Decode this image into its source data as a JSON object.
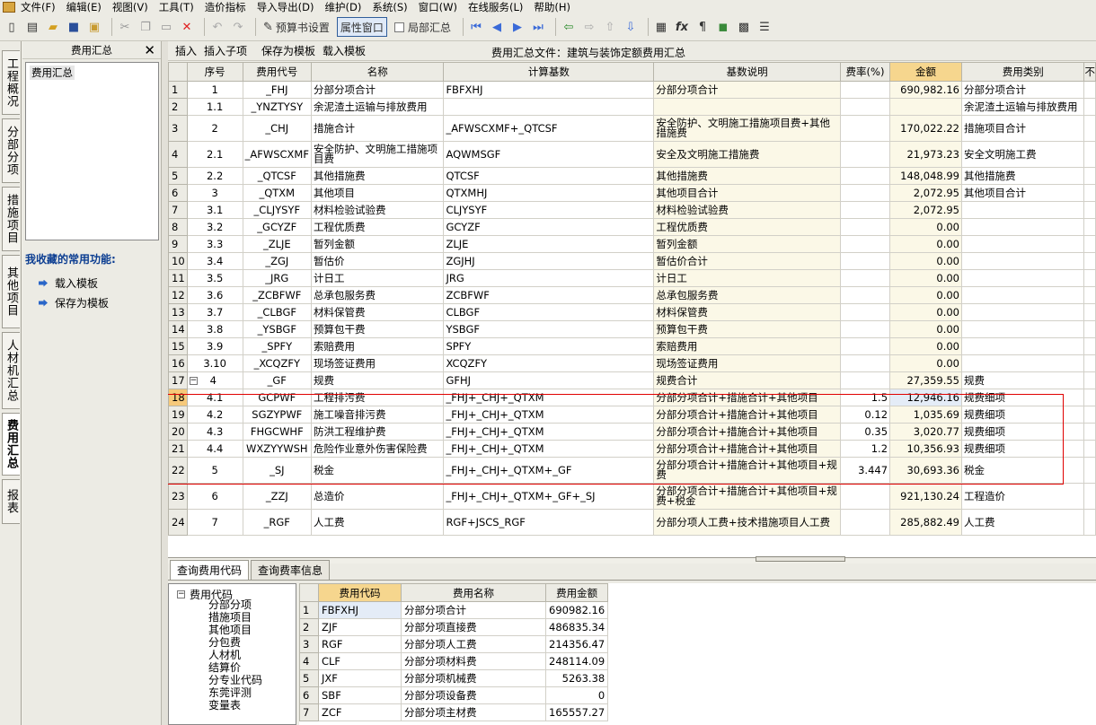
{
  "menu": [
    "文件(F)",
    "编辑(E)",
    "视图(V)",
    "工具(T)",
    "造价指标",
    "导入导出(D)",
    "维护(D)",
    "系统(S)",
    "窗口(W)",
    "在线服务(L)",
    "帮助(H)"
  ],
  "toolbar": {
    "budget_setting": "预算书设置",
    "attr_window": "属性窗口",
    "local_summary": "局部汇总"
  },
  "vtabs": [
    "工程概况",
    "分部分项",
    "措施项目",
    "其他项目",
    "人材机汇总",
    "费用汇总",
    "报表"
  ],
  "left_panel": {
    "title": "费用汇总",
    "tree_item": "费用汇总",
    "fav_title": "我收藏的常用功能:",
    "fav_items": [
      "载入模板",
      "保存为模板"
    ]
  },
  "main_toolbar": {
    "insert": "插入",
    "insert_child": "插入子项",
    "save_template": "保存为模板",
    "load_template": "载入模板",
    "file_title": "费用汇总文件：建筑与装饰定额费用汇总"
  },
  "grid": {
    "columns": [
      "序号",
      "费用代号",
      "名称",
      "计算基数",
      "基数说明",
      "费率(%)",
      "金额",
      "费用类别",
      "不"
    ],
    "rows": [
      [
        "1",
        "_FHJ",
        "分部分项合计",
        "FBFXHJ",
        "分部分项合计",
        "",
        "690,982.16",
        "分部分项合计"
      ],
      [
        "1.1",
        "_YNZTYSY",
        "余泥渣土运输与排放费用",
        "",
        "",
        "",
        "",
        "余泥渣土运输与排放费用"
      ],
      [
        "2",
        "_CHJ",
        "措施合计",
        "_AFWSCXMF+_QTCSF",
        "安全防护、文明施工措施项目费+其他措施费",
        "",
        "170,022.22",
        "措施项目合计"
      ],
      [
        "2.1",
        "_AFWSCXMF",
        "安全防护、文明施工措施项目费",
        "AQWMSGF",
        "安全及文明施工措施费",
        "",
        "21,973.23",
        "安全文明施工费"
      ],
      [
        "2.2",
        "_QTCSF",
        "其他措施费",
        "QTCSF",
        "其他措施费",
        "",
        "148,048.99",
        "其他措施费"
      ],
      [
        "3",
        "_QTXM",
        "其他项目",
        "QTXMHJ",
        "其他项目合计",
        "",
        "2,072.95",
        "其他项目合计"
      ],
      [
        "3.1",
        "_CLJYSYF",
        "材料检验试验费",
        "CLJYSYF",
        "材料检验试验费",
        "",
        "2,072.95",
        ""
      ],
      [
        "3.2",
        "_GCYZF",
        "工程优质费",
        "GCYZF",
        "工程优质费",
        "",
        "0.00",
        ""
      ],
      [
        "3.3",
        "_ZLJE",
        "暂列金额",
        "ZLJE",
        "暂列金额",
        "",
        "0.00",
        ""
      ],
      [
        "3.4",
        "_ZGJ",
        "暂估价",
        "ZGJHJ",
        "暂估价合计",
        "",
        "0.00",
        ""
      ],
      [
        "3.5",
        "_JRG",
        "计日工",
        "JRG",
        "计日工",
        "",
        "0.00",
        ""
      ],
      [
        "3.6",
        "_ZCBFWF",
        "总承包服务费",
        "ZCBFWF",
        "总承包服务费",
        "",
        "0.00",
        ""
      ],
      [
        "3.7",
        "_CLBGF",
        "材料保管费",
        "CLBGF",
        "材料保管费",
        "",
        "0.00",
        ""
      ],
      [
        "3.8",
        "_YSBGF",
        "预算包干费",
        "YSBGF",
        "预算包干费",
        "",
        "0.00",
        ""
      ],
      [
        "3.9",
        "_SPFY",
        "索赔费用",
        "SPFY",
        "索赔费用",
        "",
        "0.00",
        ""
      ],
      [
        "3.10",
        "_XCQZFY",
        "现场签证费用",
        "XCQZFY",
        "现场签证费用",
        "",
        "0.00",
        ""
      ],
      [
        "4",
        "_GF",
        "规费",
        "GFHJ",
        "规费合计",
        "",
        "27,359.55",
        "规费"
      ],
      [
        "4.1",
        "GCPWF",
        "工程排污费",
        "_FHJ+_CHJ+_QTXM",
        "分部分项合计+措施合计+其他项目",
        "1.5",
        "12,946.16",
        "规费细项"
      ],
      [
        "4.2",
        "SGZYPWF",
        "施工噪音排污费",
        "_FHJ+_CHJ+_QTXM",
        "分部分项合计+措施合计+其他项目",
        "0.12",
        "1,035.69",
        "规费细项"
      ],
      [
        "4.3",
        "FHGCWHF",
        "防洪工程维护费",
        "_FHJ+_CHJ+_QTXM",
        "分部分项合计+措施合计+其他项目",
        "0.35",
        "3,020.77",
        "规费细项"
      ],
      [
        "4.4",
        "WXZYYWSH",
        "危险作业意外伤害保险费",
        "_FHJ+_CHJ+_QTXM",
        "分部分项合计+措施合计+其他项目",
        "1.2",
        "10,356.93",
        "规费细项"
      ],
      [
        "5",
        "_SJ",
        "税金",
        "_FHJ+_CHJ+_QTXM+_GF",
        "分部分项合计+措施合计+其他项目+规费",
        "3.447",
        "30,693.36",
        "税金"
      ],
      [
        "6",
        "_ZZJ",
        "总造价",
        "_FHJ+_CHJ+_QTXM+_GF+_SJ",
        "分部分项合计+措施合计+其他项目+规费+税金",
        "",
        "921,130.24",
        "工程造价"
      ],
      [
        "7",
        "_RGF",
        "人工费",
        "RGF+JSCS_RGF",
        "分部分项人工费+技术措施项目人工费",
        "",
        "285,882.49",
        "人工费"
      ]
    ]
  },
  "bottom": {
    "tabs": [
      "查询费用代码",
      "查询费率信息"
    ],
    "tree_root": "费用代码",
    "tree_items": [
      "分部分项",
      "措施项目",
      "其他项目",
      "分包费",
      "人材机",
      "结算价",
      "分专业代码",
      "东莞评测",
      "变量表"
    ],
    "columns": [
      "费用代码",
      "费用名称",
      "费用金额"
    ],
    "rows": [
      [
        "FBFXHJ",
        "分部分项合计",
        "690982.16"
      ],
      [
        "ZJF",
        "分部分项直接费",
        "486835.34"
      ],
      [
        "RGF",
        "分部分项人工费",
        "214356.47"
      ],
      [
        "CLF",
        "分部分项材料费",
        "248114.09"
      ],
      [
        "JXF",
        "分部分项机械费",
        "5263.38"
      ],
      [
        "SBF",
        "分部分项设备费",
        "0"
      ],
      [
        "ZCF",
        "分部分项主材费",
        "165557.27"
      ]
    ]
  },
  "colors": {
    "header_highlight": "#f6d68e",
    "selection_box": "#e00000",
    "link_blue": "#0b3d91"
  }
}
